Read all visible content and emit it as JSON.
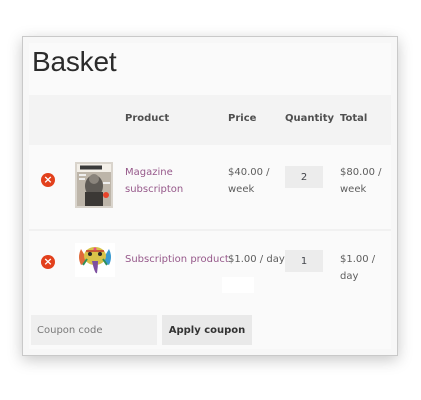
{
  "page": {
    "title": "Basket"
  },
  "table": {
    "headers": {
      "product": "Product",
      "price": "Price",
      "quantity": "Quantity",
      "total": "Total"
    },
    "rows": [
      {
        "remove_symbol": "×",
        "thumbnail_icon": "magazine-cover",
        "product_line1": "Magazine",
        "product_line2": "subscripton",
        "price_line1": "$40.00 /",
        "price_line2": "week",
        "quantity": "2",
        "total_line1": "$80.00 /",
        "total_line2": "week"
      },
      {
        "remove_symbol": "×",
        "thumbnail_icon": "elephant-poster",
        "product": "Subscription product",
        "price": "$1.00 / day",
        "quantity": "1",
        "total": "$1.00 / day"
      }
    ]
  },
  "coupon": {
    "placeholder": "Coupon code",
    "apply_label": "Apply coupon"
  },
  "colors": {
    "remove": "#e2401c",
    "link": "#96588a"
  }
}
